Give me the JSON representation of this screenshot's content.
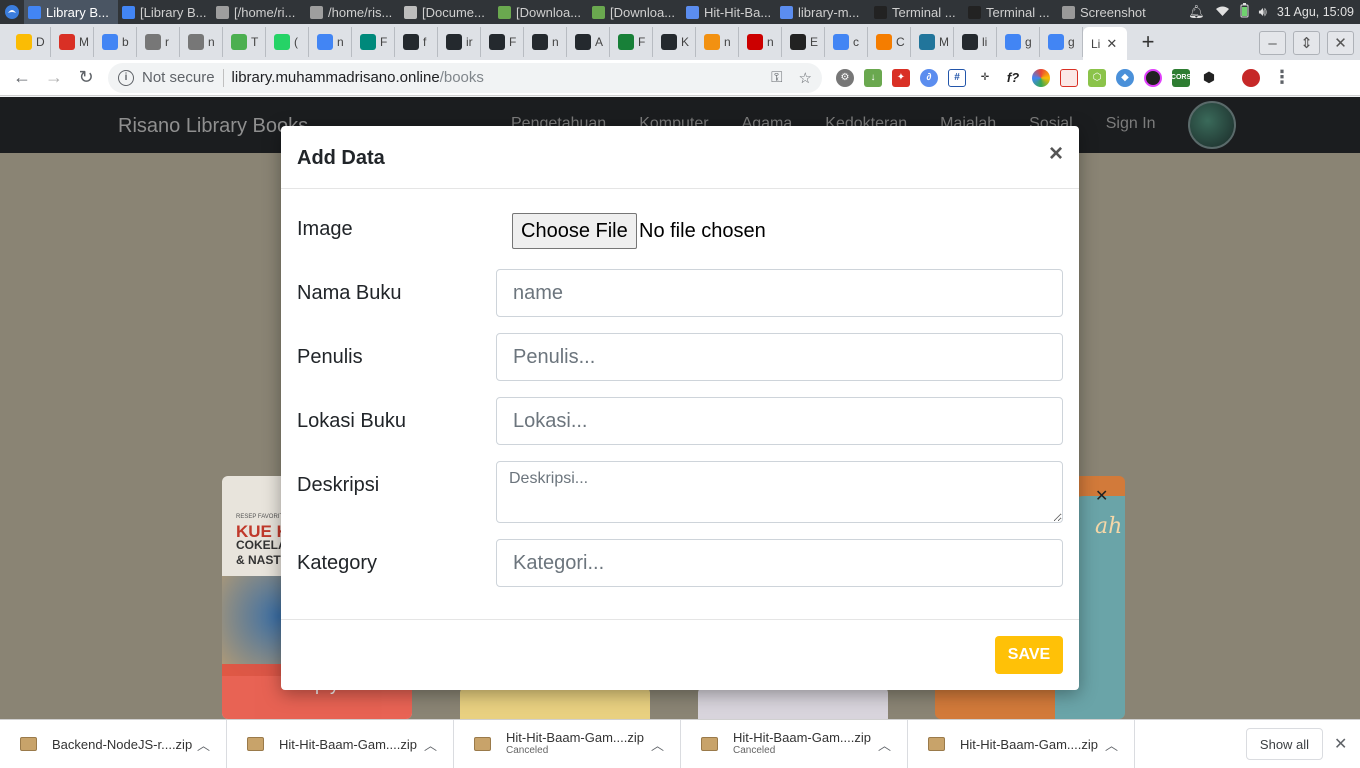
{
  "os_panel": {
    "tasks": [
      {
        "label": "Library B...",
        "active": true
      },
      {
        "label": "[Library B...",
        "active": false
      },
      {
        "label": "[/home/ri...",
        "active": false
      },
      {
        "label": "/home/ris...",
        "active": false
      },
      {
        "label": "[Docume...",
        "active": false
      },
      {
        "label": "[Downloa...",
        "active": false
      },
      {
        "label": "[Downloa...",
        "active": false
      },
      {
        "label": "Hit-Hit-Ba...",
        "active": false
      },
      {
        "label": "library-m...",
        "active": false
      },
      {
        "label": "Terminal ...",
        "active": false
      },
      {
        "label": "Terminal ...",
        "active": false
      },
      {
        "label": "Screenshot",
        "active": false
      }
    ],
    "clock": "31 Agu, 15:09"
  },
  "browser": {
    "tabs": [
      {
        "icon": "google-drive-icon",
        "label": "D",
        "color": "#fbbc04"
      },
      {
        "icon": "pdf-icon",
        "label": "M",
        "color": "#d93025"
      },
      {
        "icon": "google-icon",
        "label": "b",
        "color": "#4285f4"
      },
      {
        "icon": "globe-icon",
        "label": "r",
        "color": "#777777"
      },
      {
        "icon": "globe-icon",
        "label": "n",
        "color": "#777777"
      },
      {
        "icon": "leaf-icon",
        "label": "T",
        "color": "#4caf50"
      },
      {
        "icon": "whatsapp-icon",
        "label": "(",
        "color": "#25d366"
      },
      {
        "icon": "google-icon",
        "label": "n",
        "color": "#4285f4"
      },
      {
        "icon": "circle-icon",
        "label": "F",
        "color": "#00897b"
      },
      {
        "icon": "github-icon",
        "label": "f",
        "color": "#24292e"
      },
      {
        "icon": "github-icon",
        "label": "ir",
        "color": "#24292e"
      },
      {
        "icon": "github-icon",
        "label": "F",
        "color": "#24292e"
      },
      {
        "icon": "github-icon",
        "label": "n",
        "color": "#24292e"
      },
      {
        "icon": "github-icon",
        "label": "A",
        "color": "#24292e"
      },
      {
        "icon": "plus-icon",
        "label": "F",
        "color": "#188038"
      },
      {
        "icon": "github-icon",
        "label": "K",
        "color": "#24292e"
      },
      {
        "icon": "pma-icon",
        "label": "n",
        "color": "#f29111"
      },
      {
        "icon": "n-icon",
        "label": "n",
        "color": "#cc0000"
      },
      {
        "icon": "react-icon",
        "label": "E",
        "color": "#222222"
      },
      {
        "icon": "google-icon",
        "label": "c",
        "color": "#4285f4"
      },
      {
        "icon": "blogger-icon",
        "label": "C",
        "color": "#f57d00"
      },
      {
        "icon": "wordpress-icon",
        "label": "M",
        "color": "#21759b"
      },
      {
        "icon": "github-icon",
        "label": "li",
        "color": "#24292e"
      },
      {
        "icon": "google-icon",
        "label": "g",
        "color": "#4285f4"
      },
      {
        "icon": "google-icon",
        "label": "g",
        "color": "#4285f4"
      }
    ],
    "active_tab_label": "Li",
    "url_security": "Not secure",
    "url_domain": "library.muhammadrisano.online",
    "url_path": "/books"
  },
  "site": {
    "brand": "Risano Library Books",
    "nav_links": [
      "Pengetahuan",
      "Komputer",
      "Agama",
      "Kedokteran",
      "Majalah",
      "Sosial"
    ],
    "sign_in": "Sign In",
    "card_overlay_text": "Empty",
    "card_close": "✕",
    "book1_cover_small": "RESEP FAVORIT",
    "book1_cover_title": "KUE K",
    "book1_cover_line2": "COKELA",
    "book1_cover_line3": "& NAST",
    "book4_cover_script": "ah"
  },
  "modal": {
    "title": "Add Data",
    "close": "×",
    "fields": {
      "image_label": "Image",
      "file_button": "Choose File",
      "file_status": "No file chosen",
      "nama_label": "Nama Buku",
      "nama_placeholder": "name",
      "penulis_label": "Penulis",
      "penulis_placeholder": "Penulis...",
      "lokasi_label": "Lokasi Buku",
      "lokasi_placeholder": "Lokasi...",
      "deskripsi_label": "Deskripsi",
      "deskripsi_placeholder": "Deskripsi...",
      "kategori_label": "Kategory",
      "kategori_placeholder": "Kategori..."
    },
    "save_label": "SAVE"
  },
  "downloads": {
    "items": [
      {
        "name": "Backend-NodeJS-r....zip",
        "status": ""
      },
      {
        "name": "Hit-Hit-Baam-Gam....zip",
        "status": ""
      },
      {
        "name": "Hit-Hit-Baam-Gam....zip",
        "status": "Canceled"
      },
      {
        "name": "Hit-Hit-Baam-Gam....zip",
        "status": "Canceled"
      },
      {
        "name": "Hit-Hit-Baam-Gam....zip",
        "status": ""
      }
    ],
    "show_all": "Show all"
  },
  "colors": {
    "accent_save": "#ffc107",
    "site_nav_bg": "#1b1d1f"
  }
}
